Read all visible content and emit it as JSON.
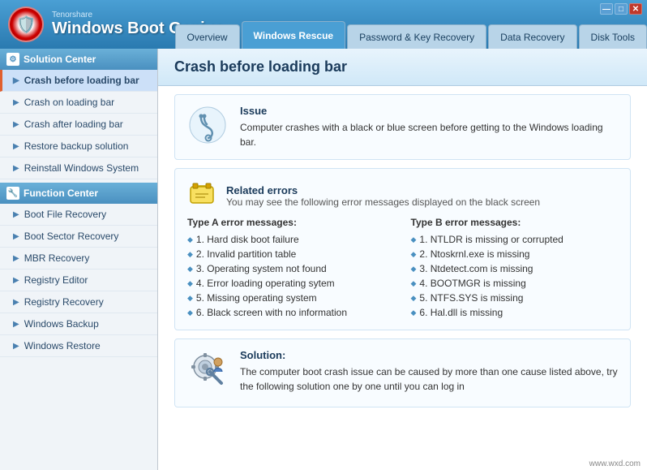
{
  "titlebar": {
    "subtitle": "Tenorshare",
    "title": "Windows Boot Genius",
    "controls": {
      "minimize": "—",
      "maximize": "□",
      "close": "✕"
    }
  },
  "nav": {
    "tabs": [
      {
        "id": "overview",
        "label": "Overview",
        "active": false
      },
      {
        "id": "windows-rescue",
        "label": "Windows Rescue",
        "active": true
      },
      {
        "id": "password-recovery",
        "label": "Password & Key Recovery",
        "active": false
      },
      {
        "id": "data-recovery",
        "label": "Data Recovery",
        "active": false
      },
      {
        "id": "disk-tools",
        "label": "Disk Tools",
        "active": false
      }
    ]
  },
  "sidebar": {
    "section1": {
      "title": "Solution Center",
      "items": [
        {
          "id": "crash-before",
          "label": "Crash before loading bar",
          "active": true
        },
        {
          "id": "crash-on",
          "label": "Crash on loading bar",
          "active": false
        },
        {
          "id": "crash-after",
          "label": "Crash after loading bar",
          "active": false
        },
        {
          "id": "restore-backup",
          "label": "Restore backup solution",
          "active": false
        },
        {
          "id": "reinstall-windows",
          "label": "Reinstall Windows System",
          "active": false
        }
      ]
    },
    "section2": {
      "title": "Function Center",
      "items": [
        {
          "id": "boot-file",
          "label": "Boot File Recovery",
          "active": false
        },
        {
          "id": "boot-sector",
          "label": "Boot Sector Recovery",
          "active": false
        },
        {
          "id": "mbr-recovery",
          "label": "MBR Recovery",
          "active": false
        },
        {
          "id": "registry-editor",
          "label": "Registry Editor",
          "active": false
        },
        {
          "id": "registry-recovery",
          "label": "Registry Recovery",
          "active": false
        },
        {
          "id": "windows-backup",
          "label": "Windows Backup",
          "active": false
        },
        {
          "id": "windows-restore",
          "label": "Windows Restore",
          "active": false
        }
      ]
    }
  },
  "content": {
    "page_title": "Crash before loading bar",
    "issue_card": {
      "title": "Issue",
      "text": "Computer crashes with a black or blue screen before getting to the Windows loading bar."
    },
    "related_errors": {
      "title": "Related errors",
      "subtitle": "You may see the following error messages displayed on the black screen",
      "col_a_title": "Type A error messages:",
      "col_a_items": [
        "1. Hard disk boot failure",
        "2. Invalid partition table",
        "3. Operating system not found",
        "4. Error loading operating sytem",
        "5. Missing operating system",
        "6. Black screen with no information"
      ],
      "col_b_title": "Type B error messages:",
      "col_b_items": [
        "1. NTLDR is missing or corrupted",
        "2. Ntoskrnl.exe is missing",
        "3. Ntdetect.com is missing",
        "4. BOOTMGR is missing",
        "5. NTFS.SYS is missing",
        "6. Hal.dll is missing"
      ]
    },
    "solution_card": {
      "title": "Solution:",
      "text": "The computer boot crash issue can be caused by more than one cause listed above, try the following solution one by one until you can log in"
    }
  },
  "watermark": "www.wxd.com"
}
